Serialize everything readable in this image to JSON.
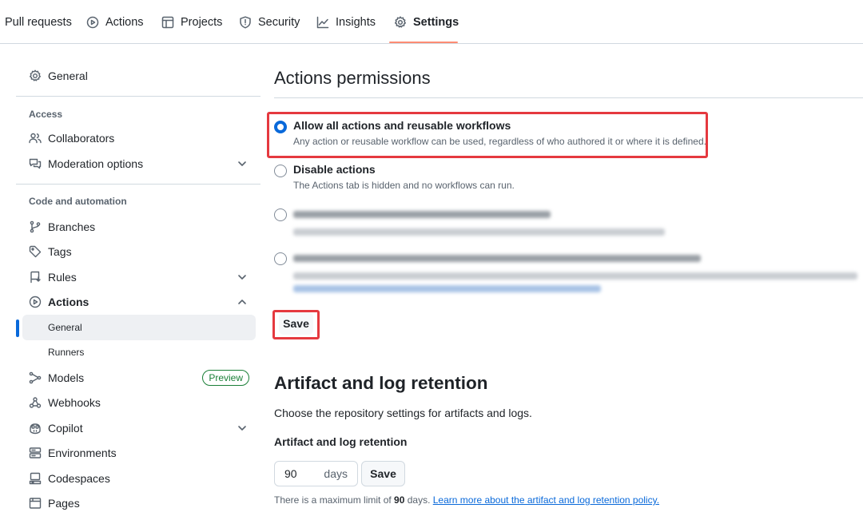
{
  "tabs": [
    {
      "label": "Pull requests",
      "icon": "git-pull-request-icon"
    },
    {
      "label": "Actions",
      "icon": "play-icon"
    },
    {
      "label": "Projects",
      "icon": "table-icon"
    },
    {
      "label": "Security",
      "icon": "shield-icon"
    },
    {
      "label": "Insights",
      "icon": "graph-icon"
    },
    {
      "label": "Settings",
      "icon": "gear-icon",
      "active": true
    }
  ],
  "sidebar": {
    "general": "General",
    "access_heading": "Access",
    "collaborators": "Collaborators",
    "moderation": "Moderation options",
    "code_heading": "Code and automation",
    "branches": "Branches",
    "tags": "Tags",
    "rules": "Rules",
    "actions": "Actions",
    "actions_general": "General",
    "actions_runners": "Runners",
    "models": "Models",
    "models_badge": "Preview",
    "webhooks": "Webhooks",
    "copilot": "Copilot",
    "environments": "Environments",
    "codespaces": "Codespaces",
    "pages": "Pages"
  },
  "main": {
    "permissions_title": "Actions permissions",
    "options": [
      {
        "label": "Allow all actions and reusable workflows",
        "desc": "Any action or reusable workflow can be used, regardless of who authored it or where it is defined.",
        "checked": true
      },
      {
        "label": "Disable actions",
        "desc": "The Actions tab is hidden and no workflows can run.",
        "checked": false
      }
    ],
    "save_label": "Save",
    "retention_title": "Artifact and log retention",
    "retention_desc": "Choose the repository settings for artifacts and logs.",
    "retention_label": "Artifact and log retention",
    "retention_value": "90",
    "retention_unit": "days",
    "retention_save": "Save",
    "limit_prefix": "There is a maximum limit of ",
    "limit_value": "90",
    "limit_suffix": " days. ",
    "limit_link": "Learn more about the artifact and log retention policy."
  },
  "colors": {
    "accent": "#0969da",
    "highlight": "#e5393f",
    "tab_underline": "#fd8c73",
    "badge_green": "#1a7f37"
  }
}
